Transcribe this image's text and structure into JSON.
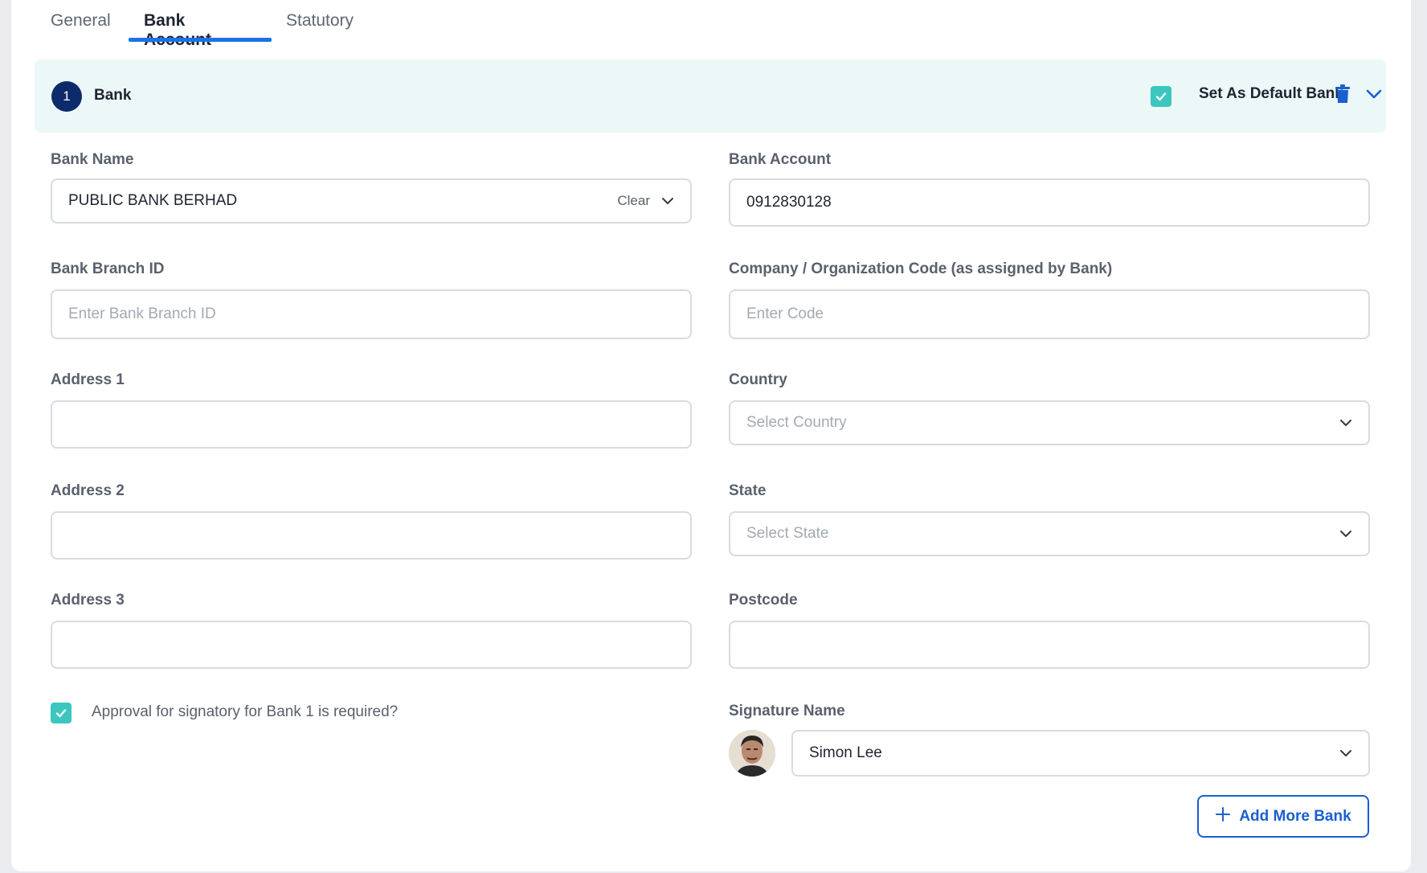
{
  "tabs": [
    {
      "label": "General",
      "active": false
    },
    {
      "label": "Bank Account",
      "active": true
    },
    {
      "label": "Statutory",
      "active": false
    }
  ],
  "bank_section": {
    "step_number": "1",
    "title": "Bank",
    "default_label": "Set As Default Bank",
    "default_checked": true
  },
  "form": {
    "bank_name": {
      "label": "Bank Name",
      "value": "PUBLIC BANK BERHAD",
      "clear_label": "Clear"
    },
    "bank_account": {
      "label": "Bank Account",
      "value": "0912830128"
    },
    "bank_branch_id": {
      "label": "Bank Branch ID",
      "placeholder": "Enter Bank Branch ID"
    },
    "company_code": {
      "label": "Company / Organization Code (as assigned by Bank)",
      "placeholder": "Enter Code"
    },
    "address1": {
      "label": "Address 1",
      "value": ""
    },
    "country": {
      "label": "Country",
      "placeholder": "Select Country"
    },
    "address2": {
      "label": "Address 2",
      "value": ""
    },
    "state": {
      "label": "State",
      "placeholder": "Select State"
    },
    "address3": {
      "label": "Address 3",
      "value": ""
    },
    "postcode": {
      "label": "Postcode",
      "value": ""
    },
    "approval": {
      "label": "Approval for signatory for Bank 1 is required?",
      "checked": true
    },
    "signature": {
      "label": "Signature Name",
      "value": "Simon Lee"
    }
  },
  "actions": {
    "add_more_bank": "Add More Bank"
  },
  "colors": {
    "accent": "#1a73e8",
    "checkbox": "#3cc6c0",
    "header_bg": "#ecf8f8",
    "badge": "#0d2b6b",
    "button_text": "#1a5fd0"
  }
}
